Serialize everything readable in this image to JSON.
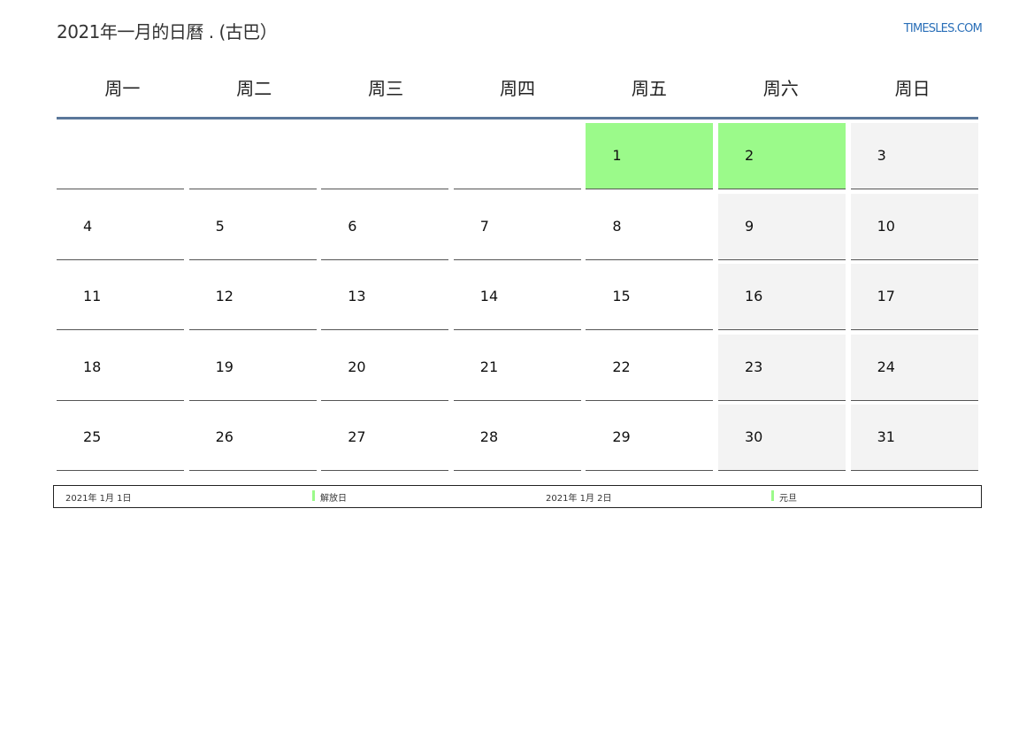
{
  "header": {
    "title": "2021年一月的日曆 . (古巴）",
    "site": "TIMESLES.COM"
  },
  "weekdays": [
    "周一",
    "周二",
    "周三",
    "周四",
    "周五",
    "周六",
    "周日"
  ],
  "calendar": {
    "rows": [
      [
        {
          "day": "",
          "type": "normal"
        },
        {
          "day": "",
          "type": "normal"
        },
        {
          "day": "",
          "type": "normal"
        },
        {
          "day": "",
          "type": "normal"
        },
        {
          "day": "1",
          "type": "holiday"
        },
        {
          "day": "2",
          "type": "holiday"
        },
        {
          "day": "3",
          "type": "weekend"
        }
      ],
      [
        {
          "day": "4",
          "type": "normal"
        },
        {
          "day": "5",
          "type": "normal"
        },
        {
          "day": "6",
          "type": "normal"
        },
        {
          "day": "7",
          "type": "normal"
        },
        {
          "day": "8",
          "type": "normal"
        },
        {
          "day": "9",
          "type": "weekend"
        },
        {
          "day": "10",
          "type": "weekend"
        }
      ],
      [
        {
          "day": "11",
          "type": "normal"
        },
        {
          "day": "12",
          "type": "normal"
        },
        {
          "day": "13",
          "type": "normal"
        },
        {
          "day": "14",
          "type": "normal"
        },
        {
          "day": "15",
          "type": "normal"
        },
        {
          "day": "16",
          "type": "weekend"
        },
        {
          "day": "17",
          "type": "weekend"
        }
      ],
      [
        {
          "day": "18",
          "type": "normal"
        },
        {
          "day": "19",
          "type": "normal"
        },
        {
          "day": "20",
          "type": "normal"
        },
        {
          "day": "21",
          "type": "normal"
        },
        {
          "day": "22",
          "type": "normal"
        },
        {
          "day": "23",
          "type": "weekend"
        },
        {
          "day": "24",
          "type": "weekend"
        }
      ],
      [
        {
          "day": "25",
          "type": "normal"
        },
        {
          "day": "26",
          "type": "normal"
        },
        {
          "day": "27",
          "type": "normal"
        },
        {
          "day": "28",
          "type": "normal"
        },
        {
          "day": "29",
          "type": "normal"
        },
        {
          "day": "30",
          "type": "weekend"
        },
        {
          "day": "31",
          "type": "weekend"
        }
      ]
    ]
  },
  "holidays": [
    {
      "date": "2021年 1月 1日",
      "name": "解放日"
    },
    {
      "date": "2021年 1月 2日",
      "name": "元旦"
    }
  ],
  "colors": {
    "holiday": "#9bfa8a",
    "weekend": "#f3f3f3",
    "header_rule": "#5a779a",
    "link": "#2a6fb8"
  }
}
